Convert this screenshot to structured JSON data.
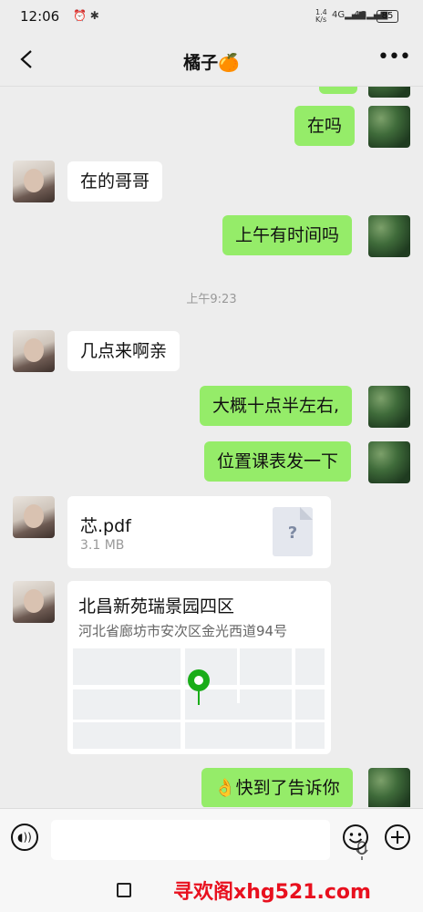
{
  "status_bar": {
    "time": "12:06",
    "net_speed_top": "1.4",
    "net_speed_bottom": "K/s",
    "network_1": "4G",
    "network_2": "4G",
    "battery": "85"
  },
  "header": {
    "title": "橘子🍊"
  },
  "messages": {
    "m1": "在吗",
    "m2": "在的哥哥",
    "m3": "上午有时间吗",
    "time": "上午9:23",
    "m4": "几点来啊亲",
    "m5": "大概十点半左右,",
    "m6": "位置课表发一下",
    "file": {
      "name": "芯.pdf",
      "size": "3.1 MB",
      "icon": "?"
    },
    "location": {
      "title": "北昌新苑瑞景园四区",
      "address": "河北省廊坊市安次区金光西道94号"
    },
    "m7_emoji": "👌",
    "m7": "快到了告诉你"
  },
  "nav_bar": {
    "watermark": "寻欢阁xhg521.com"
  },
  "colors": {
    "outgoing_bubble": "#95ec69",
    "incoming_bubble": "#ffffff",
    "background": "#ededed",
    "map_pin": "#1aad19"
  }
}
